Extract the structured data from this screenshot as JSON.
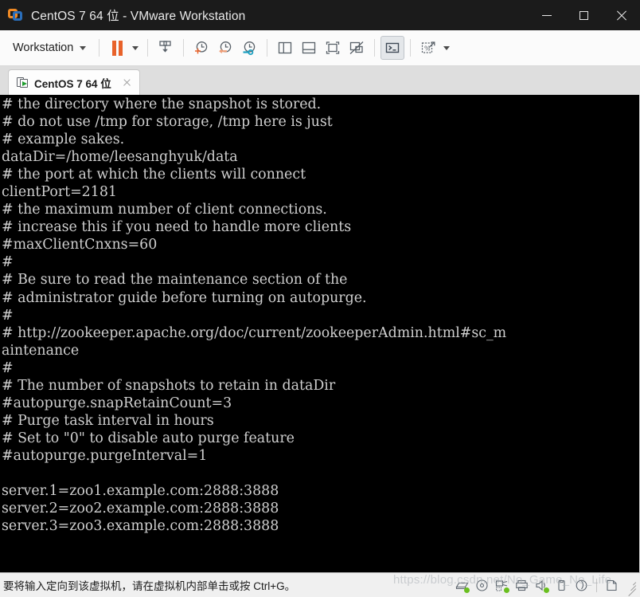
{
  "window": {
    "title": "CentOS 7 64 位 - VMware Workstation",
    "logo_icon": "vmware-logo-icon",
    "controls": {
      "minimize": "minimize-icon",
      "maximize": "maximize-icon",
      "close": "close-icon"
    }
  },
  "toolbar": {
    "workstation_menu": "Workstation",
    "items": [
      {
        "name": "suspend-button",
        "icon": "pause-icon"
      },
      {
        "name": "power-dropdown",
        "icon": "chevron-down-icon"
      },
      {
        "name": "manage-snapshot-button",
        "icon": "snapshot-download-icon"
      },
      {
        "name": "take-snapshot-button",
        "icon": "clock-plus-icon"
      },
      {
        "name": "revert-snapshot-button",
        "icon": "clock-arrow-left-icon"
      },
      {
        "name": "snapshot-manager-button",
        "icon": "clock-wrench-icon"
      },
      {
        "name": "show-library-button",
        "icon": "panel-left-icon"
      },
      {
        "name": "show-thumbnail-bar-button",
        "icon": "panel-bottom-icon"
      },
      {
        "name": "enter-fullscreen-button",
        "icon": "fullscreen-icon"
      },
      {
        "name": "unity-mode-button",
        "icon": "unity-disabled-icon"
      },
      {
        "name": "console-view-button",
        "icon": "terminal-prompt-icon"
      },
      {
        "name": "send-key-button",
        "icon": "send-key-icon"
      },
      {
        "name": "send-key-dropdown",
        "icon": "chevron-down-icon"
      }
    ]
  },
  "tabs": [
    {
      "label": "CentOS 7 64 位",
      "icon": "vm-running-icon",
      "close_icon": "close-icon",
      "active": true
    }
  ],
  "terminal": {
    "background": "#000000",
    "foreground": "#cfcfcf",
    "lines": [
      "# the directory where the snapshot is stored.",
      "# do not use /tmp for storage, /tmp here is just",
      "# example sakes.",
      "dataDir=/home/leesanghyuk/data",
      "# the port at which the clients will connect",
      "clientPort=2181",
      "# the maximum number of client connections.",
      "# increase this if you need to handle more clients",
      "#maxClientCnxns=60",
      "#",
      "# Be sure to read the maintenance section of the",
      "# administrator guide before turning on autopurge.",
      "#",
      "# http://zookeeper.apache.org/doc/current/zookeeperAdmin.html#sc_m",
      "aintenance",
      "#",
      "# The number of snapshots to retain in dataDir",
      "#autopurge.snapRetainCount=3",
      "# Purge task interval in hours",
      "# Set to \"0\" to disable auto purge feature",
      "#autopurge.purgeInterval=1",
      "",
      "server.1=zoo1.example.com:2888:3888",
      "server.2=zoo2.example.com:2888:3888",
      "server.3=zoo3.example.com:2888:3888"
    ]
  },
  "statusbar": {
    "message": "要将输入定向到该虚拟机，请在虚拟机内部单击或按 Ctrl+G。",
    "devices": [
      {
        "name": "status-hard-disk",
        "icon": "hard-disk-icon",
        "connected": true
      },
      {
        "name": "status-cd-dvd",
        "icon": "cd-dvd-icon",
        "connected": false
      },
      {
        "name": "status-network-adapter",
        "icon": "network-adapter-icon",
        "connected": true
      },
      {
        "name": "status-printer",
        "icon": "printer-icon",
        "connected": false
      },
      {
        "name": "status-sound-card",
        "icon": "sound-card-icon",
        "connected": true
      },
      {
        "name": "status-usb-device",
        "icon": "usb-device-icon",
        "connected": false
      },
      {
        "name": "status-display",
        "icon": "display-icon",
        "connected": false
      },
      {
        "name": "status-shared-folder",
        "icon": "shared-folder-icon",
        "connected": false
      }
    ],
    "resize_grip": "resize-grip-icon"
  },
  "watermark": {
    "text": "https://blog.csdn.net/No_Game_No_Life"
  }
}
